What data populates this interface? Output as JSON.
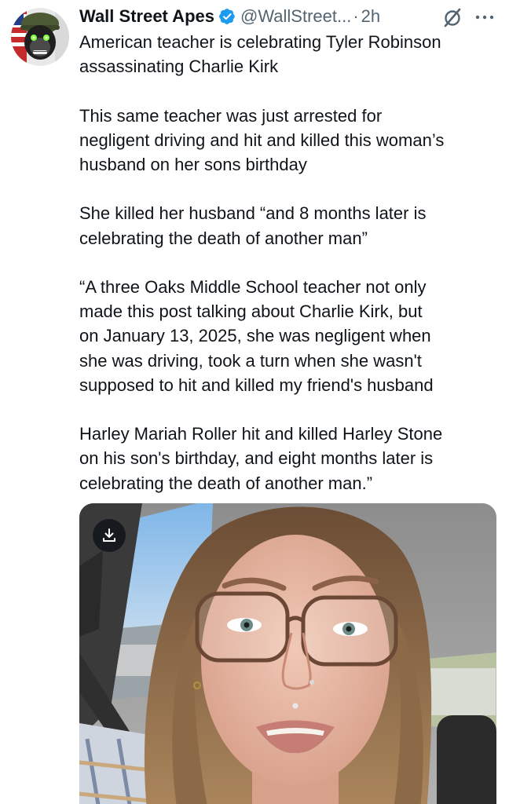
{
  "author": {
    "display_name": "Wall Street Apes",
    "handle": "@WallStreet...",
    "separator": "·",
    "time": "2h",
    "verified": true,
    "avatar_icon": "gorilla-helmet-avatar-icon"
  },
  "actions": {
    "grok_icon": "grok-slash-circle-icon",
    "more_icon": "more-dots-icon"
  },
  "tweet": {
    "paragraphs": [
      [
        "American teacher is celebrating Tyler Robinson",
        "assassinating Charlie Kirk"
      ],
      [
        "This same teacher was just arrested for",
        "negligent driving and hit and killed this woman’s",
        "husband on her sons birthday"
      ],
      [
        "She killed her husband “and 8 months later is",
        "celebrating the death of another man”"
      ],
      [
        "“A three Oaks Middle School teacher not only",
        "made this post talking about Charlie Kirk, but",
        "on January 13, 2025, she was negligent when",
        "she was driving, took a turn when she wasn't",
        "supposed to hit and killed my friend's husband"
      ],
      [
        "Harley Mariah Roller hit and killed Harley Stone",
        "on his son's birthday, and eight months later is",
        "celebrating the death of another man.”"
      ]
    ]
  },
  "media": {
    "type": "video-still",
    "download_icon": "download-icon"
  },
  "colors": {
    "text": "#0f1419",
    "secondary": "#536471",
    "verified": "#1d9bf0"
  }
}
